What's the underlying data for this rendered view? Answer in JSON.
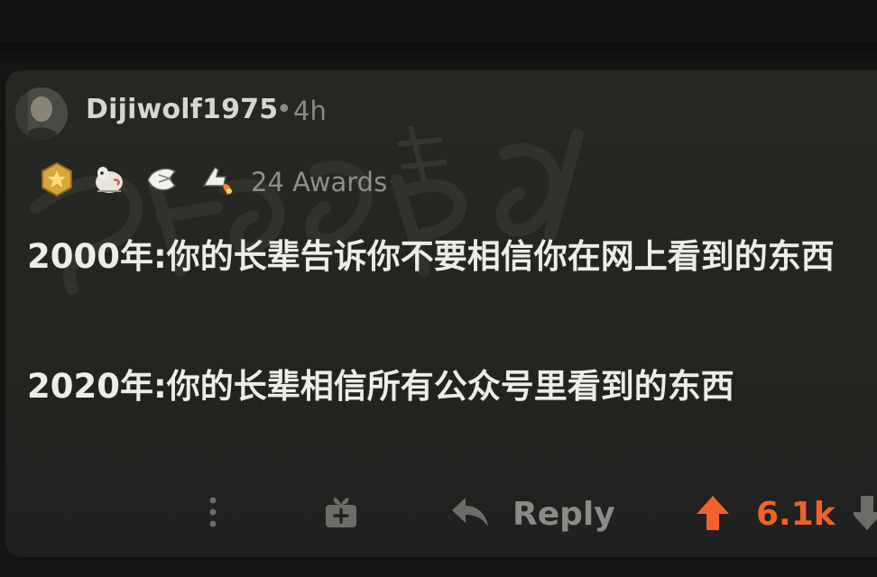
{
  "comment": {
    "username": "Dijiwolf1975",
    "separator": "•",
    "time": "4h",
    "awards": {
      "icons": [
        "gold-medal-icon",
        "wholesome-seal-icon",
        "pointing-hand-icon",
        "rocket-thumbs-up-icon"
      ],
      "count_label": "24 Awards"
    },
    "paragraphs": [
      "2000年:你的长辈告诉你不要相信你在网上看到的东西",
      "2020年:你的长辈相信所有公众号里看到的东西"
    ]
  },
  "actions": {
    "more_icon": "more-vertical-icon",
    "gift_icon": "gift-icon",
    "reply_icon": "reply-arrow-icon",
    "reply_label": "Reply",
    "upvote_icon": "upvote-arrow-icon",
    "score": "6.1k",
    "downvote_icon": "downvote-arrow-icon"
  },
  "colors": {
    "background": "#141414",
    "card": "#24241f",
    "upvote_accent": "#f0622a",
    "text_primary": "#ecece8",
    "text_muted": "#8a8a86"
  }
}
